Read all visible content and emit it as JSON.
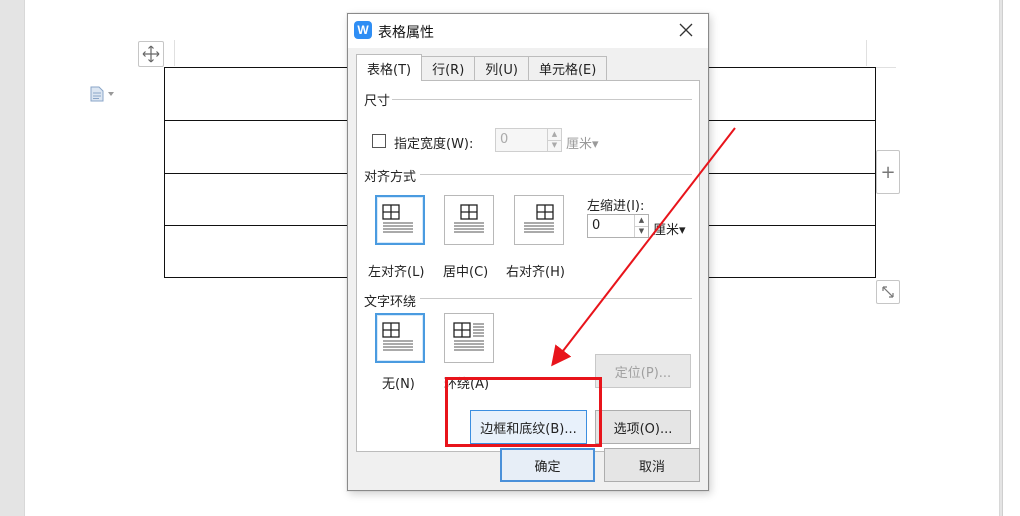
{
  "document": {
    "add_col_label": "+"
  },
  "dialog": {
    "title": "表格属性",
    "app_icon_letter": "W",
    "tabs": [
      {
        "label": "表格(T)",
        "active": true
      },
      {
        "label": "行(R)",
        "active": false
      },
      {
        "label": "列(U)",
        "active": false
      },
      {
        "label": "单元格(E)",
        "active": false
      }
    ],
    "size_section": {
      "title": "尺寸",
      "checkbox_label": "指定宽度(W):",
      "checked": false,
      "width_value": "0",
      "width_unit": "厘米▾"
    },
    "alignment_section": {
      "title": "对齐方式",
      "options": [
        "左对齐(L)",
        "居中(C)",
        "右对齐(H)"
      ],
      "selected": "左对齐(L)",
      "indent_label": "左缩进(I):",
      "indent_value": "0",
      "indent_unit": "厘米▾"
    },
    "wrap_section": {
      "title": "文字环绕",
      "options": [
        "无(N)",
        "环绕(A)"
      ],
      "selected": "无(N)",
      "position_button": "定位(P)..."
    },
    "borders_button": "边框和底纹(B)...",
    "options_button": "选项(O)...",
    "ok_button": "确定",
    "cancel_button": "取消"
  },
  "annotation": {
    "highlight_color": "#e8141b",
    "arrow_color": "#e8141b"
  }
}
